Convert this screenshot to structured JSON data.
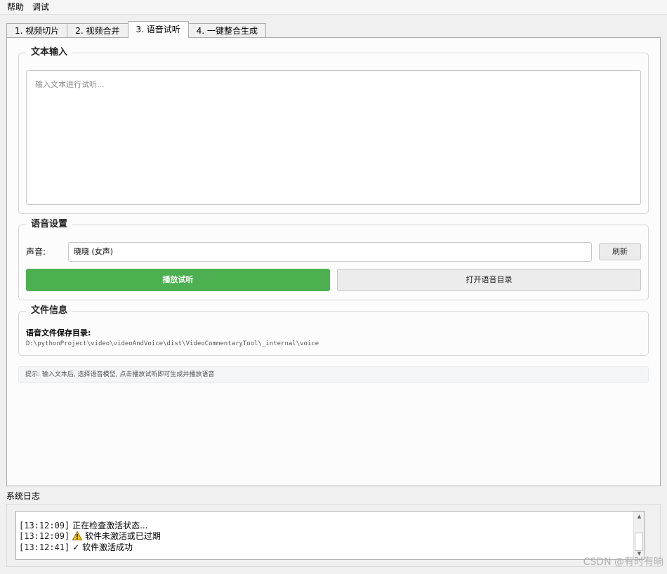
{
  "menu": [
    "帮助",
    "调试"
  ],
  "tabs": [
    "1. 视频切片",
    "2. 视频合并",
    "3. 语音试听",
    "4. 一键整合生成"
  ],
  "text_input": {
    "title": "文本输入",
    "placeholder": "输入文本进行试听..."
  },
  "voice_settings": {
    "title": "语音设置",
    "voice_label": "声音:",
    "voice_value": "晓晓 (女声)",
    "refresh_label": "刷新",
    "play_label": "播放试听",
    "open_dir_label": "打开语音目录",
    "play_color": "#4caf50"
  },
  "file_info": {
    "title": "文件信息",
    "label": "语音文件保存目录:",
    "path": "D:\\pythonProject\\video\\videoAndVoice\\dist\\VideoCommentaryTool\\_internal\\voice"
  },
  "hint": "提示: 输入文本后, 选择语音模型, 点击播放试听即可生成并播放语音",
  "log": {
    "title": "系统日志",
    "lines": [
      {
        "time": "[13:12:09]",
        "icon": "",
        "text": "正在检查激活状态..."
      },
      {
        "time": "[13:12:09]",
        "icon": "warning-icon",
        "text": "软件未激活或已过期"
      },
      {
        "time": "[13:12:41]",
        "icon": "check-icon",
        "text": "软件激活成功"
      }
    ]
  },
  "watermark": "CSDN @有时有晌"
}
